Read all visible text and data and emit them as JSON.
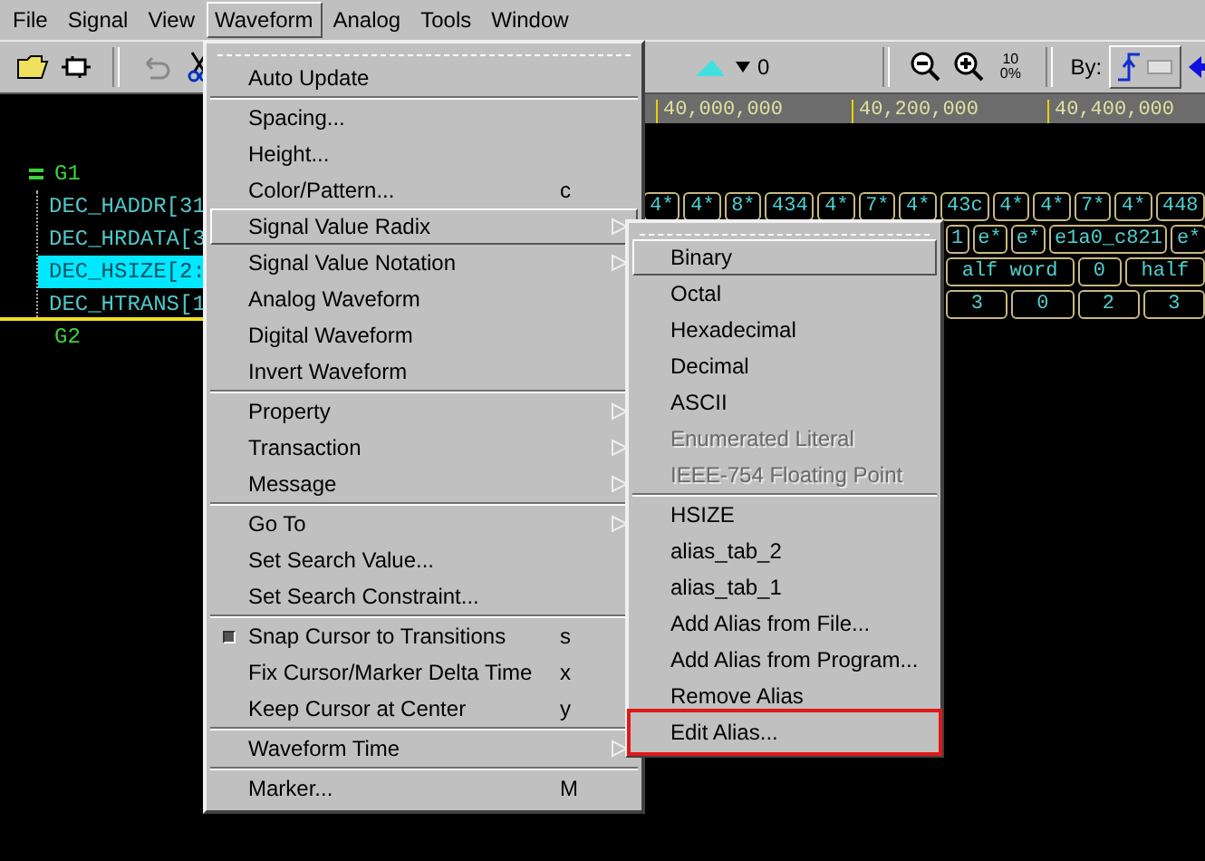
{
  "menubar": [
    {
      "label": "File",
      "selected": false
    },
    {
      "label": "Signal",
      "selected": false
    },
    {
      "label": "View",
      "selected": false
    },
    {
      "label": "Waveform",
      "selected": true
    },
    {
      "label": "Analog",
      "selected": false
    },
    {
      "label": "Tools",
      "selected": false
    },
    {
      "label": "Window",
      "selected": false
    }
  ],
  "toolbar": {
    "cursor_value": "0",
    "zoom_full": "100%",
    "by_label": "By:"
  },
  "ruler": {
    "ticks": [
      "40,000,000",
      "40,200,000",
      "40,400,000"
    ]
  },
  "signals": [
    {
      "name": "G1",
      "kind": "group",
      "expanded": true,
      "children": [
        {
          "name": "DEC_HADDR[31",
          "selected": false
        },
        {
          "name": "DEC_HRDATA[3",
          "selected": false
        },
        {
          "name": "DEC_HSIZE[2:",
          "selected": true
        },
        {
          "name": "DEC_HTRANS[1",
          "selected": false
        }
      ]
    },
    {
      "name": "G2",
      "kind": "group"
    }
  ],
  "waveforms": [
    {
      "segments": [
        "4*",
        "4*",
        "8*",
        "434",
        "4*",
        "7*",
        "4*",
        "43c",
        "4*",
        "4*",
        "7*",
        "4*",
        "448"
      ]
    },
    {
      "segments": [
        "1",
        "e*",
        "e*",
        "e1a0_c821",
        "e*"
      ]
    },
    {
      "segments": [
        "alf word",
        "0",
        "half"
      ]
    },
    {
      "segments": [
        "3",
        "0",
        "2",
        "3"
      ]
    }
  ],
  "waveform_menu": {
    "items": [
      {
        "kind": "tearoff"
      },
      {
        "kind": "item",
        "label": "Auto Update",
        "selected": false
      },
      {
        "kind": "separator"
      },
      {
        "kind": "item",
        "label": "Spacing...",
        "selected": false
      },
      {
        "kind": "item",
        "label": "Height...",
        "selected": false
      },
      {
        "kind": "item",
        "label": "Color/Pattern...",
        "shortcut": "c",
        "selected": false
      },
      {
        "kind": "submenu",
        "label": "Signal Value Radix",
        "selected": true
      },
      {
        "kind": "submenu",
        "label": "Signal Value Notation",
        "selected": false
      },
      {
        "kind": "item",
        "label": "Analog Waveform",
        "selected": false
      },
      {
        "kind": "item",
        "label": "Digital Waveform",
        "selected": false
      },
      {
        "kind": "item",
        "label": "Invert Waveform",
        "selected": false
      },
      {
        "kind": "separator"
      },
      {
        "kind": "submenu",
        "label": "Property",
        "selected": false
      },
      {
        "kind": "submenu",
        "label": "Transaction",
        "selected": false
      },
      {
        "kind": "submenu",
        "label": "Message",
        "selected": false
      },
      {
        "kind": "separator"
      },
      {
        "kind": "submenu",
        "label": "Go To",
        "selected": false
      },
      {
        "kind": "item",
        "label": "Set Search Value...",
        "selected": false
      },
      {
        "kind": "item",
        "label": "Set Search Constraint...",
        "selected": false
      },
      {
        "kind": "separator"
      },
      {
        "kind": "check",
        "label": "Snap Cursor to Transitions",
        "shortcut": "s",
        "checked": true,
        "selected": false
      },
      {
        "kind": "check",
        "label": "Fix Cursor/Marker Delta Time",
        "shortcut": "x",
        "checked": false,
        "selected": false
      },
      {
        "kind": "check",
        "label": "Keep Cursor at Center",
        "shortcut": "y",
        "checked": false,
        "selected": false
      },
      {
        "kind": "separator"
      },
      {
        "kind": "submenu",
        "label": "Waveform Time",
        "selected": false
      },
      {
        "kind": "separator"
      },
      {
        "kind": "item",
        "label": "Marker...",
        "shortcut": "M",
        "selected": false
      }
    ]
  },
  "radix_submenu": {
    "items": [
      {
        "kind": "tearoff"
      },
      {
        "kind": "item",
        "label": "Binary",
        "selected": true,
        "disabled": false,
        "outlined": false
      },
      {
        "kind": "item",
        "label": "Octal",
        "selected": false,
        "disabled": false,
        "outlined": false
      },
      {
        "kind": "item",
        "label": "Hexadecimal",
        "selected": false,
        "disabled": false,
        "outlined": false
      },
      {
        "kind": "item",
        "label": "Decimal",
        "selected": false,
        "disabled": false,
        "outlined": false
      },
      {
        "kind": "item",
        "label": "ASCII",
        "selected": false,
        "disabled": false,
        "outlined": false
      },
      {
        "kind": "item",
        "label": "Enumerated Literal",
        "selected": false,
        "disabled": true,
        "outlined": false
      },
      {
        "kind": "item",
        "label": "IEEE-754 Floating Point",
        "selected": false,
        "disabled": true,
        "outlined": false
      },
      {
        "kind": "separator"
      },
      {
        "kind": "item",
        "label": "HSIZE",
        "selected": false,
        "disabled": false,
        "outlined": false
      },
      {
        "kind": "item",
        "label": "alias_tab_2",
        "selected": false,
        "disabled": false,
        "outlined": false
      },
      {
        "kind": "item",
        "label": "alias_tab_1",
        "selected": false,
        "disabled": false,
        "outlined": false
      },
      {
        "kind": "item",
        "label": "Add Alias from File...",
        "selected": false,
        "disabled": false,
        "outlined": false
      },
      {
        "kind": "item",
        "label": "Add Alias from Program...",
        "selected": false,
        "disabled": false,
        "outlined": false
      },
      {
        "kind": "item",
        "label": "Remove Alias",
        "selected": false,
        "disabled": false,
        "outlined": false
      },
      {
        "kind": "item",
        "label": "Edit Alias...",
        "selected": false,
        "disabled": false,
        "outlined": true
      }
    ]
  }
}
